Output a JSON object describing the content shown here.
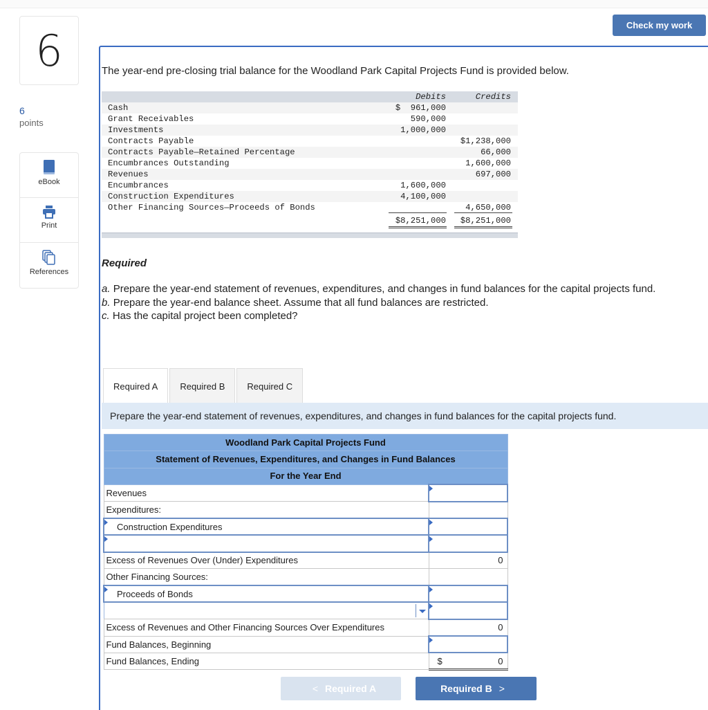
{
  "question": {
    "number": "6",
    "points_value": "6",
    "points_label": "points"
  },
  "tools": [
    {
      "label": "eBook",
      "icon": "book-icon"
    },
    {
      "label": "Print",
      "icon": "printer-icon"
    },
    {
      "label": "References",
      "icon": "copies-icon"
    }
  ],
  "header": {
    "check_button": "Check my work"
  },
  "intro": "The year-end pre-closing trial balance for the Woodland Park Capital Projects Fund is provided below.",
  "trial_balance": {
    "headers": {
      "debits": "Debits",
      "credits": "Credits"
    },
    "rows": [
      {
        "account": "Cash",
        "debit": "$  961,000",
        "credit": ""
      },
      {
        "account": "Grant Receivables",
        "debit": "590,000",
        "credit": ""
      },
      {
        "account": "Investments",
        "debit": "1,000,000",
        "credit": ""
      },
      {
        "account": "Contracts Payable",
        "debit": "",
        "credit": "$1,238,000"
      },
      {
        "account": "Contracts Payable—Retained Percentage",
        "debit": "",
        "credit": "66,000"
      },
      {
        "account": "Encumbrances Outstanding",
        "debit": "",
        "credit": "1,600,000"
      },
      {
        "account": "Revenues",
        "debit": "",
        "credit": "697,000"
      },
      {
        "account": "Encumbrances",
        "debit": "1,600,000",
        "credit": ""
      },
      {
        "account": "Construction Expenditures",
        "debit": "4,100,000",
        "credit": ""
      },
      {
        "account": "Other Financing Sources—Proceeds of Bonds",
        "debit": "",
        "credit": "4,650,000"
      }
    ],
    "totals": {
      "debit": "$8,251,000",
      "credit": "$8,251,000"
    }
  },
  "required": {
    "title": "Required",
    "items": [
      {
        "letter": "a.",
        "text": "Prepare the year-end statement of revenues, expenditures, and changes in fund balances for the capital projects fund."
      },
      {
        "letter": "b.",
        "text": "Prepare the year-end balance sheet. Assume that all fund balances are restricted."
      },
      {
        "letter": "c.",
        "text": "Has the capital project been completed?"
      }
    ]
  },
  "tabs": [
    {
      "label": "Required A",
      "active": true
    },
    {
      "label": "Required B",
      "active": false
    },
    {
      "label": "Required C",
      "active": false
    }
  ],
  "instruction": "Prepare the year-end statement of revenues, expenditures, and changes in fund balances for the capital projects fund.",
  "statement": {
    "title1": "Woodland Park Capital Projects Fund",
    "title2": "Statement of Revenues, Expenditures, and Changes in Fund Balances",
    "title3": "For the Year End",
    "rows": {
      "revenues": {
        "label": "Revenues",
        "value": ""
      },
      "expenditures_header": {
        "label": "Expenditures:"
      },
      "construction": {
        "label": "Construction Expenditures",
        "value": ""
      },
      "blank_exp": {
        "label": "",
        "value": ""
      },
      "excess1": {
        "label": "Excess of Revenues Over (Under) Expenditures",
        "value": "0"
      },
      "ofs_header": {
        "label": "Other Financing Sources:"
      },
      "bonds": {
        "label": "Proceeds of Bonds",
        "value": ""
      },
      "dropdown": {
        "label": "",
        "value": ""
      },
      "excess2": {
        "label": "Excess of Revenues and Other Financing Sources Over Expenditures",
        "value": "0"
      },
      "fb_begin": {
        "label": "Fund Balances, Beginning",
        "value": ""
      },
      "fb_end": {
        "label": "Fund Balances, Ending",
        "currency": "$",
        "value": "0"
      }
    }
  },
  "nav": {
    "prev_label": "Required A",
    "next_label": "Required B",
    "prev_chevron": "<",
    "next_chevron": ">"
  }
}
